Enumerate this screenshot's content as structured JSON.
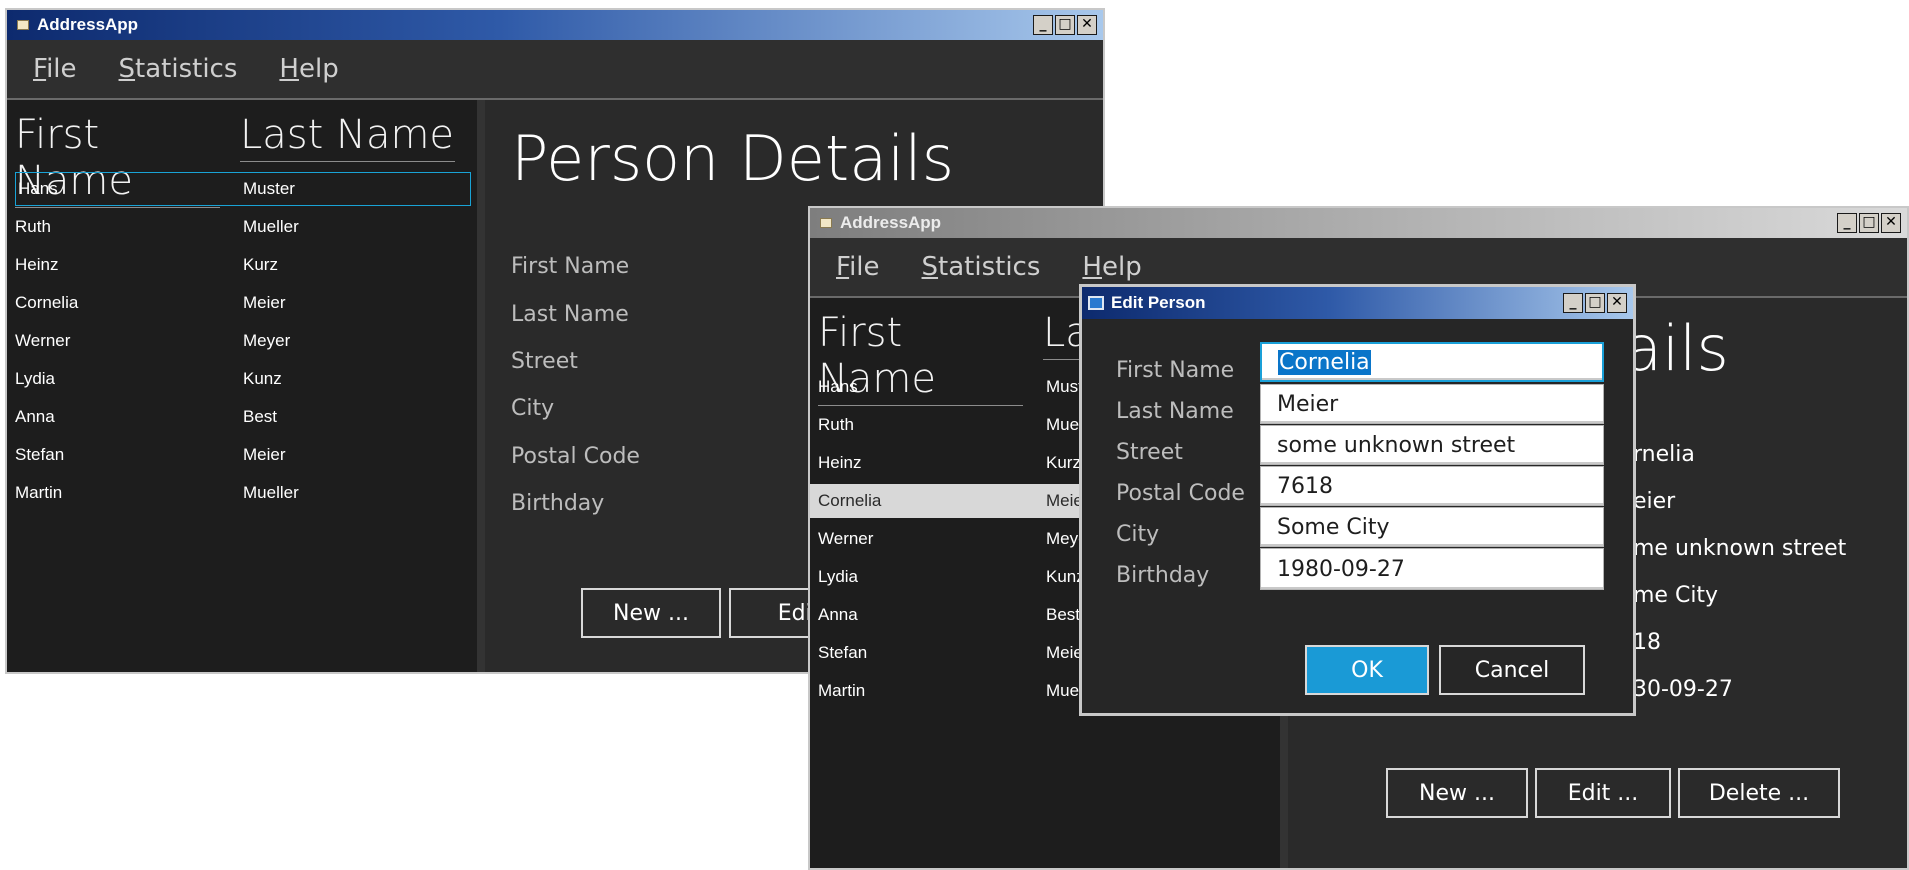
{
  "window1": {
    "title": "AddressApp",
    "menu": [
      "File",
      "Statistics",
      "Help"
    ],
    "table": {
      "headers": [
        "First Name",
        "Last Name"
      ],
      "rows": [
        [
          "Hans",
          "Muster"
        ],
        [
          "Ruth",
          "Mueller"
        ],
        [
          "Heinz",
          "Kurz"
        ],
        [
          "Cornelia",
          "Meier"
        ],
        [
          "Werner",
          "Meyer"
        ],
        [
          "Lydia",
          "Kunz"
        ],
        [
          "Anna",
          "Best"
        ],
        [
          "Stefan",
          "Meier"
        ],
        [
          "Martin",
          "Mueller"
        ]
      ],
      "focused_row": 0
    },
    "details": {
      "title": "Person Details",
      "labels": [
        "First Name",
        "Last Name",
        "Street",
        "City",
        "Postal Code",
        "Birthday"
      ]
    },
    "buttons": {
      "new": "New ...",
      "edit": "Edit"
    }
  },
  "window2": {
    "title": "AddressApp",
    "menu": [
      "File",
      "Statistics",
      "Help"
    ],
    "table": {
      "headers": [
        "First Name",
        "La"
      ],
      "rows": [
        [
          "Hans",
          "Must"
        ],
        [
          "Ruth",
          "Muel"
        ],
        [
          "Heinz",
          "Kurz"
        ],
        [
          "Cornelia",
          "Meie"
        ],
        [
          "Werner",
          "Meye"
        ],
        [
          "Lydia",
          "Kunz"
        ],
        [
          "Anna",
          "Best"
        ],
        [
          "Stefan",
          "Meie"
        ],
        [
          "Martin",
          "Muel"
        ]
      ],
      "selected_row": 3
    },
    "details": {
      "title_fragment": "ails",
      "values": [
        "rnelia",
        "eier",
        "me unknown street",
        "me City",
        "18",
        "30-09-27"
      ]
    },
    "buttons": {
      "new": "New ...",
      "edit": "Edit ...",
      "delete": "Delete ..."
    }
  },
  "dialog": {
    "title": "Edit Person",
    "fields": [
      {
        "label": "First Name",
        "value": "Cornelia"
      },
      {
        "label": "Last Name",
        "value": "Meier"
      },
      {
        "label": "Street",
        "value": "some unknown street"
      },
      {
        "label": "Postal Code",
        "value": "7618"
      },
      {
        "label": "City",
        "value": "Some City"
      },
      {
        "label": "Birthday",
        "value": "1980-09-27"
      }
    ],
    "ok": "OK",
    "cancel": "Cancel",
    "colors": {
      "ok_bg": "#1a9ad6",
      "selection": "#0a75c9",
      "focus": "#1aa0d8"
    }
  },
  "window_controls": [
    "_",
    "□",
    "✕"
  ]
}
